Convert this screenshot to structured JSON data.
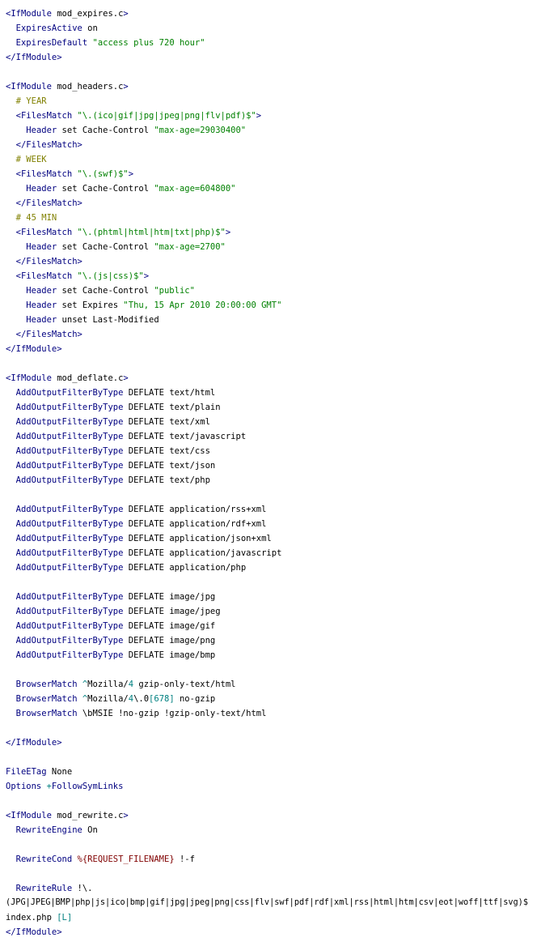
{
  "colors": {
    "tag": "#000080",
    "string": "#008000",
    "directive": "#000080",
    "comment": "#808000",
    "number": "#008080",
    "text": "#000000",
    "operator": "#008080",
    "variable": "#800000",
    "background": "#ffffff"
  },
  "lines": [
    [
      {
        "t": "tag",
        "v": "<IfModule"
      },
      {
        "t": "txt",
        "v": " mod_expires.c"
      },
      {
        "t": "tag",
        "v": ">"
      }
    ],
    [
      {
        "t": "txt",
        "v": "  "
      },
      {
        "t": "dir",
        "v": "ExpiresActive"
      },
      {
        "t": "txt",
        "v": " on"
      }
    ],
    [
      {
        "t": "txt",
        "v": "  "
      },
      {
        "t": "dir",
        "v": "ExpiresDefault"
      },
      {
        "t": "txt",
        "v": " "
      },
      {
        "t": "str",
        "v": "\"access plus 720 hour\""
      }
    ],
    [
      {
        "t": "tag",
        "v": "</IfModule>"
      }
    ],
    [],
    [
      {
        "t": "tag",
        "v": "<IfModule"
      },
      {
        "t": "txt",
        "v": " mod_headers.c"
      },
      {
        "t": "tag",
        "v": ">"
      }
    ],
    [
      {
        "t": "txt",
        "v": "  "
      },
      {
        "t": "cmt",
        "v": "# YEAR"
      }
    ],
    [
      {
        "t": "txt",
        "v": "  "
      },
      {
        "t": "tag",
        "v": "<FilesMatch"
      },
      {
        "t": "txt",
        "v": " "
      },
      {
        "t": "str",
        "v": "\"\\.(ico|gif|jpg|jpeg|png|flv|pdf)$\""
      },
      {
        "t": "tag",
        "v": ">"
      }
    ],
    [
      {
        "t": "txt",
        "v": "    "
      },
      {
        "t": "dir",
        "v": "Header"
      },
      {
        "t": "txt",
        "v": " set Cache-Control "
      },
      {
        "t": "str",
        "v": "\"max-age=29030400\""
      }
    ],
    [
      {
        "t": "txt",
        "v": "  "
      },
      {
        "t": "tag",
        "v": "</FilesMatch>"
      }
    ],
    [
      {
        "t": "txt",
        "v": "  "
      },
      {
        "t": "cmt",
        "v": "# WEEK"
      }
    ],
    [
      {
        "t": "txt",
        "v": "  "
      },
      {
        "t": "tag",
        "v": "<FilesMatch"
      },
      {
        "t": "txt",
        "v": " "
      },
      {
        "t": "str",
        "v": "\"\\.(swf)$\""
      },
      {
        "t": "tag",
        "v": ">"
      }
    ],
    [
      {
        "t": "txt",
        "v": "    "
      },
      {
        "t": "dir",
        "v": "Header"
      },
      {
        "t": "txt",
        "v": " set Cache-Control "
      },
      {
        "t": "str",
        "v": "\"max-age=604800\""
      }
    ],
    [
      {
        "t": "txt",
        "v": "  "
      },
      {
        "t": "tag",
        "v": "</FilesMatch>"
      }
    ],
    [
      {
        "t": "txt",
        "v": "  "
      },
      {
        "t": "cmt",
        "v": "# 45 MIN"
      }
    ],
    [
      {
        "t": "txt",
        "v": "  "
      },
      {
        "t": "tag",
        "v": "<FilesMatch"
      },
      {
        "t": "txt",
        "v": " "
      },
      {
        "t": "str",
        "v": "\"\\.(phtml|html|htm|txt|php)$\""
      },
      {
        "t": "tag",
        "v": ">"
      }
    ],
    [
      {
        "t": "txt",
        "v": "    "
      },
      {
        "t": "dir",
        "v": "Header"
      },
      {
        "t": "txt",
        "v": " set Cache-Control "
      },
      {
        "t": "str",
        "v": "\"max-age=2700\""
      }
    ],
    [
      {
        "t": "txt",
        "v": "  "
      },
      {
        "t": "tag",
        "v": "</FilesMatch>"
      }
    ],
    [
      {
        "t": "txt",
        "v": "  "
      },
      {
        "t": "tag",
        "v": "<FilesMatch"
      },
      {
        "t": "txt",
        "v": " "
      },
      {
        "t": "str",
        "v": "\"\\.(js|css)$\""
      },
      {
        "t": "tag",
        "v": ">"
      }
    ],
    [
      {
        "t": "txt",
        "v": "    "
      },
      {
        "t": "dir",
        "v": "Header"
      },
      {
        "t": "txt",
        "v": " set Cache-Control "
      },
      {
        "t": "str",
        "v": "\"public\""
      }
    ],
    [
      {
        "t": "txt",
        "v": "    "
      },
      {
        "t": "dir",
        "v": "Header"
      },
      {
        "t": "txt",
        "v": " set Expires "
      },
      {
        "t": "str",
        "v": "\"Thu, 15 Apr 2010 20:00:00 GMT\""
      }
    ],
    [
      {
        "t": "txt",
        "v": "    "
      },
      {
        "t": "dir",
        "v": "Header"
      },
      {
        "t": "txt",
        "v": " unset Last-Modified"
      }
    ],
    [
      {
        "t": "txt",
        "v": "  "
      },
      {
        "t": "tag",
        "v": "</FilesMatch>"
      }
    ],
    [
      {
        "t": "tag",
        "v": "</IfModule>"
      }
    ],
    [],
    [
      {
        "t": "tag",
        "v": "<IfModule"
      },
      {
        "t": "txt",
        "v": " mod_deflate.c"
      },
      {
        "t": "tag",
        "v": ">"
      }
    ],
    [
      {
        "t": "txt",
        "v": "  "
      },
      {
        "t": "dir",
        "v": "AddOutputFilterByType"
      },
      {
        "t": "txt",
        "v": " DEFLATE text/html"
      }
    ],
    [
      {
        "t": "txt",
        "v": "  "
      },
      {
        "t": "dir",
        "v": "AddOutputFilterByType"
      },
      {
        "t": "txt",
        "v": " DEFLATE text/plain"
      }
    ],
    [
      {
        "t": "txt",
        "v": "  "
      },
      {
        "t": "dir",
        "v": "AddOutputFilterByType"
      },
      {
        "t": "txt",
        "v": " DEFLATE text/xml"
      }
    ],
    [
      {
        "t": "txt",
        "v": "  "
      },
      {
        "t": "dir",
        "v": "AddOutputFilterByType"
      },
      {
        "t": "txt",
        "v": " DEFLATE text/javascript"
      }
    ],
    [
      {
        "t": "txt",
        "v": "  "
      },
      {
        "t": "dir",
        "v": "AddOutputFilterByType"
      },
      {
        "t": "txt",
        "v": " DEFLATE text/css"
      }
    ],
    [
      {
        "t": "txt",
        "v": "  "
      },
      {
        "t": "dir",
        "v": "AddOutputFilterByType"
      },
      {
        "t": "txt",
        "v": " DEFLATE text/json"
      }
    ],
    [
      {
        "t": "txt",
        "v": "  "
      },
      {
        "t": "dir",
        "v": "AddOutputFilterByType"
      },
      {
        "t": "txt",
        "v": " DEFLATE text/php"
      }
    ],
    [],
    [
      {
        "t": "txt",
        "v": "  "
      },
      {
        "t": "dir",
        "v": "AddOutputFilterByType"
      },
      {
        "t": "txt",
        "v": " DEFLATE application/rss+xml"
      }
    ],
    [
      {
        "t": "txt",
        "v": "  "
      },
      {
        "t": "dir",
        "v": "AddOutputFilterByType"
      },
      {
        "t": "txt",
        "v": " DEFLATE application/rdf+xml"
      }
    ],
    [
      {
        "t": "txt",
        "v": "  "
      },
      {
        "t": "dir",
        "v": "AddOutputFilterByType"
      },
      {
        "t": "txt",
        "v": " DEFLATE application/json+xml"
      }
    ],
    [
      {
        "t": "txt",
        "v": "  "
      },
      {
        "t": "dir",
        "v": "AddOutputFilterByType"
      },
      {
        "t": "txt",
        "v": " DEFLATE application/javascript"
      }
    ],
    [
      {
        "t": "txt",
        "v": "  "
      },
      {
        "t": "dir",
        "v": "AddOutputFilterByType"
      },
      {
        "t": "txt",
        "v": " DEFLATE application/php"
      }
    ],
    [],
    [
      {
        "t": "txt",
        "v": "  "
      },
      {
        "t": "dir",
        "v": "AddOutputFilterByType"
      },
      {
        "t": "txt",
        "v": " DEFLATE image/jpg"
      }
    ],
    [
      {
        "t": "txt",
        "v": "  "
      },
      {
        "t": "dir",
        "v": "AddOutputFilterByType"
      },
      {
        "t": "txt",
        "v": " DEFLATE image/jpeg"
      }
    ],
    [
      {
        "t": "txt",
        "v": "  "
      },
      {
        "t": "dir",
        "v": "AddOutputFilterByType"
      },
      {
        "t": "txt",
        "v": " DEFLATE image/gif"
      }
    ],
    [
      {
        "t": "txt",
        "v": "  "
      },
      {
        "t": "dir",
        "v": "AddOutputFilterByType"
      },
      {
        "t": "txt",
        "v": " DEFLATE image/png"
      }
    ],
    [
      {
        "t": "txt",
        "v": "  "
      },
      {
        "t": "dir",
        "v": "AddOutputFilterByType"
      },
      {
        "t": "txt",
        "v": " DEFLATE image/bmp"
      }
    ],
    [],
    [
      {
        "t": "txt",
        "v": "  "
      },
      {
        "t": "dir",
        "v": "BrowserMatch"
      },
      {
        "t": "txt",
        "v": " "
      },
      {
        "t": "op",
        "v": "^"
      },
      {
        "t": "txt",
        "v": "Mozilla/"
      },
      {
        "t": "num",
        "v": "4"
      },
      {
        "t": "txt",
        "v": " gzip-only-text/html"
      }
    ],
    [
      {
        "t": "txt",
        "v": "  "
      },
      {
        "t": "dir",
        "v": "BrowserMatch"
      },
      {
        "t": "txt",
        "v": " "
      },
      {
        "t": "op",
        "v": "^"
      },
      {
        "t": "txt",
        "v": "Mozilla/"
      },
      {
        "t": "num",
        "v": "4"
      },
      {
        "t": "txt",
        "v": "\\.0"
      },
      {
        "t": "num",
        "v": "[678]"
      },
      {
        "t": "txt",
        "v": " no-gzip"
      }
    ],
    [
      {
        "t": "txt",
        "v": "  "
      },
      {
        "t": "dir",
        "v": "BrowserMatch"
      },
      {
        "t": "txt",
        "v": " \\bMSIE !no-gzip !gzip-only-text/html"
      }
    ],
    [],
    [
      {
        "t": "tag",
        "v": "</IfModule>"
      }
    ],
    [],
    [
      {
        "t": "dir",
        "v": "FileETag"
      },
      {
        "t": "txt",
        "v": " None"
      }
    ],
    [
      {
        "t": "dir",
        "v": "Options"
      },
      {
        "t": "txt",
        "v": " "
      },
      {
        "t": "op",
        "v": "+"
      },
      {
        "t": "dir",
        "v": "FollowSymLinks"
      }
    ],
    [],
    [
      {
        "t": "tag",
        "v": "<IfModule"
      },
      {
        "t": "txt",
        "v": " mod_rewrite.c"
      },
      {
        "t": "tag",
        "v": ">"
      }
    ],
    [
      {
        "t": "txt",
        "v": "  "
      },
      {
        "t": "dir",
        "v": "RewriteEngine"
      },
      {
        "t": "txt",
        "v": " On"
      }
    ],
    [],
    [
      {
        "t": "txt",
        "v": "  "
      },
      {
        "t": "dir",
        "v": "RewriteCond"
      },
      {
        "t": "txt",
        "v": " "
      },
      {
        "t": "var",
        "v": "%{REQUEST_FILENAME}"
      },
      {
        "t": "txt",
        "v": " !-f"
      }
    ],
    [],
    [
      {
        "t": "txt",
        "v": "  "
      },
      {
        "t": "dir",
        "v": "RewriteRule"
      },
      {
        "t": "txt",
        "v": " !\\."
      }
    ],
    [
      {
        "t": "txt",
        "v": "(JPG|JPEG|BMP|php|js|ico|bmp|gif|jpg|jpeg|png|css|flv|swf|pdf|rdf|xml|rss|html|htm|csv|eot|woff|ttf|svg)$"
      }
    ],
    [
      {
        "t": "txt",
        "v": "index.php "
      },
      {
        "t": "num",
        "v": "[L]"
      }
    ],
    [
      {
        "t": "tag",
        "v": "</IfModule>"
      }
    ]
  ]
}
